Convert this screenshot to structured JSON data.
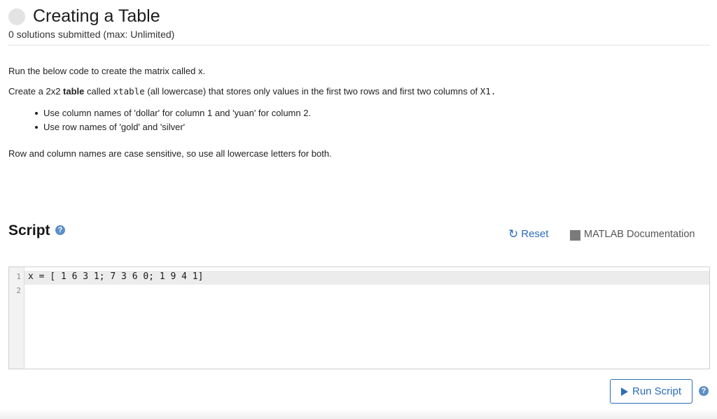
{
  "problem": {
    "title": "Creating a Table",
    "subtitle": "0 solutions submitted (max: Unlimited)"
  },
  "description": {
    "p1": "Run the below code to create the matrix called x.",
    "p2": {
      "prefix": "Create a 2x2 ",
      "bold": "table",
      "mid1": " called ",
      "code1": "xtable",
      "mid2": " (all lowercase) that stores only values in the first two rows and first two columns of ",
      "code2": "X1."
    },
    "bullets": [
      "Use column names of 'dollar' for column 1 and 'yuan' for column 2.",
      "Use row names of 'gold' and 'silver'"
    ],
    "p3": "Row and column names are case sensitive, so use all lowercase letters for both."
  },
  "script": {
    "label": "Script",
    "help_icon": "?",
    "reset_label": "Reset",
    "reset_icon": "↻",
    "doc_label": "MATLAB Documentation",
    "lines": [
      {
        "num": "1",
        "code": "x = [ 1 6 3 1; 7 3 6 0; 1 9 4 1]"
      },
      {
        "num": "2",
        "code": ""
      }
    ]
  },
  "run": {
    "label": "Run Script",
    "help_icon": "?"
  },
  "colors": {
    "accent": "#2a6ebd",
    "help_badge": "#5b8fc7"
  }
}
